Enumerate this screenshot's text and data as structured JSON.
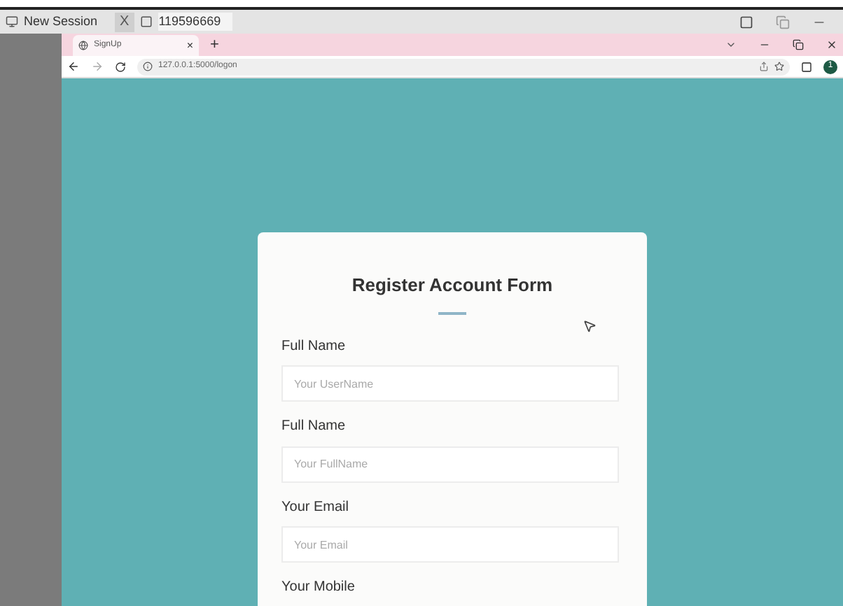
{
  "session_bar": {
    "session_label": "New Session",
    "close_label": "X",
    "session_id": "119596669"
  },
  "browser": {
    "tab": {
      "title": "SignUp",
      "close": "×"
    },
    "new_tab": "+",
    "address": "127.0.0.1:5000/logon",
    "profile_initial": "1"
  },
  "form": {
    "title": "Register Account Form",
    "fields": [
      {
        "label": "Full Name",
        "placeholder": "Your UserName"
      },
      {
        "label": "Full Name",
        "placeholder": "Your FullName"
      },
      {
        "label": "Your Email",
        "placeholder": "Your Email"
      }
    ],
    "next_label": "Your Mobile"
  }
}
